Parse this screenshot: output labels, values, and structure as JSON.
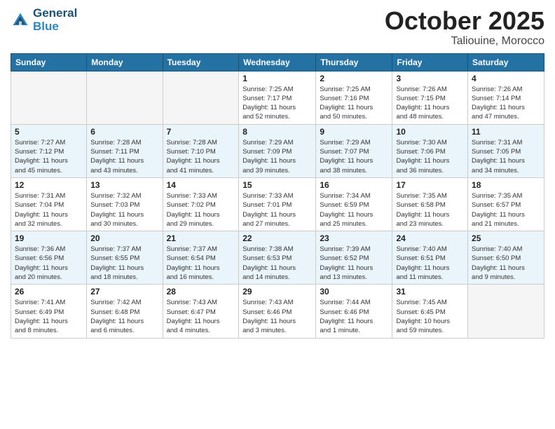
{
  "header": {
    "logo_line1": "General",
    "logo_line2": "Blue",
    "month_title": "October 2025",
    "location": "Taliouine, Morocco"
  },
  "weekdays": [
    "Sunday",
    "Monday",
    "Tuesday",
    "Wednesday",
    "Thursday",
    "Friday",
    "Saturday"
  ],
  "weeks": [
    [
      {
        "num": "",
        "info": ""
      },
      {
        "num": "",
        "info": ""
      },
      {
        "num": "",
        "info": ""
      },
      {
        "num": "1",
        "info": "Sunrise: 7:25 AM\nSunset: 7:17 PM\nDaylight: 11 hours\nand 52 minutes."
      },
      {
        "num": "2",
        "info": "Sunrise: 7:25 AM\nSunset: 7:16 PM\nDaylight: 11 hours\nand 50 minutes."
      },
      {
        "num": "3",
        "info": "Sunrise: 7:26 AM\nSunset: 7:15 PM\nDaylight: 11 hours\nand 48 minutes."
      },
      {
        "num": "4",
        "info": "Sunrise: 7:26 AM\nSunset: 7:14 PM\nDaylight: 11 hours\nand 47 minutes."
      }
    ],
    [
      {
        "num": "5",
        "info": "Sunrise: 7:27 AM\nSunset: 7:12 PM\nDaylight: 11 hours\nand 45 minutes."
      },
      {
        "num": "6",
        "info": "Sunrise: 7:28 AM\nSunset: 7:11 PM\nDaylight: 11 hours\nand 43 minutes."
      },
      {
        "num": "7",
        "info": "Sunrise: 7:28 AM\nSunset: 7:10 PM\nDaylight: 11 hours\nand 41 minutes."
      },
      {
        "num": "8",
        "info": "Sunrise: 7:29 AM\nSunset: 7:09 PM\nDaylight: 11 hours\nand 39 minutes."
      },
      {
        "num": "9",
        "info": "Sunrise: 7:29 AM\nSunset: 7:07 PM\nDaylight: 11 hours\nand 38 minutes."
      },
      {
        "num": "10",
        "info": "Sunrise: 7:30 AM\nSunset: 7:06 PM\nDaylight: 11 hours\nand 36 minutes."
      },
      {
        "num": "11",
        "info": "Sunrise: 7:31 AM\nSunset: 7:05 PM\nDaylight: 11 hours\nand 34 minutes."
      }
    ],
    [
      {
        "num": "12",
        "info": "Sunrise: 7:31 AM\nSunset: 7:04 PM\nDaylight: 11 hours\nand 32 minutes."
      },
      {
        "num": "13",
        "info": "Sunrise: 7:32 AM\nSunset: 7:03 PM\nDaylight: 11 hours\nand 30 minutes."
      },
      {
        "num": "14",
        "info": "Sunrise: 7:33 AM\nSunset: 7:02 PM\nDaylight: 11 hours\nand 29 minutes."
      },
      {
        "num": "15",
        "info": "Sunrise: 7:33 AM\nSunset: 7:01 PM\nDaylight: 11 hours\nand 27 minutes."
      },
      {
        "num": "16",
        "info": "Sunrise: 7:34 AM\nSunset: 6:59 PM\nDaylight: 11 hours\nand 25 minutes."
      },
      {
        "num": "17",
        "info": "Sunrise: 7:35 AM\nSunset: 6:58 PM\nDaylight: 11 hours\nand 23 minutes."
      },
      {
        "num": "18",
        "info": "Sunrise: 7:35 AM\nSunset: 6:57 PM\nDaylight: 11 hours\nand 21 minutes."
      }
    ],
    [
      {
        "num": "19",
        "info": "Sunrise: 7:36 AM\nSunset: 6:56 PM\nDaylight: 11 hours\nand 20 minutes."
      },
      {
        "num": "20",
        "info": "Sunrise: 7:37 AM\nSunset: 6:55 PM\nDaylight: 11 hours\nand 18 minutes."
      },
      {
        "num": "21",
        "info": "Sunrise: 7:37 AM\nSunset: 6:54 PM\nDaylight: 11 hours\nand 16 minutes."
      },
      {
        "num": "22",
        "info": "Sunrise: 7:38 AM\nSunset: 6:53 PM\nDaylight: 11 hours\nand 14 minutes."
      },
      {
        "num": "23",
        "info": "Sunrise: 7:39 AM\nSunset: 6:52 PM\nDaylight: 11 hours\nand 13 minutes."
      },
      {
        "num": "24",
        "info": "Sunrise: 7:40 AM\nSunset: 6:51 PM\nDaylight: 11 hours\nand 11 minutes."
      },
      {
        "num": "25",
        "info": "Sunrise: 7:40 AM\nSunset: 6:50 PM\nDaylight: 11 hours\nand 9 minutes."
      }
    ],
    [
      {
        "num": "26",
        "info": "Sunrise: 7:41 AM\nSunset: 6:49 PM\nDaylight: 11 hours\nand 8 minutes."
      },
      {
        "num": "27",
        "info": "Sunrise: 7:42 AM\nSunset: 6:48 PM\nDaylight: 11 hours\nand 6 minutes."
      },
      {
        "num": "28",
        "info": "Sunrise: 7:43 AM\nSunset: 6:47 PM\nDaylight: 11 hours\nand 4 minutes."
      },
      {
        "num": "29",
        "info": "Sunrise: 7:43 AM\nSunset: 6:46 PM\nDaylight: 11 hours\nand 3 minutes."
      },
      {
        "num": "30",
        "info": "Sunrise: 7:44 AM\nSunset: 6:46 PM\nDaylight: 11 hours\nand 1 minute."
      },
      {
        "num": "31",
        "info": "Sunrise: 7:45 AM\nSunset: 6:45 PM\nDaylight: 10 hours\nand 59 minutes."
      },
      {
        "num": "",
        "info": ""
      }
    ]
  ]
}
